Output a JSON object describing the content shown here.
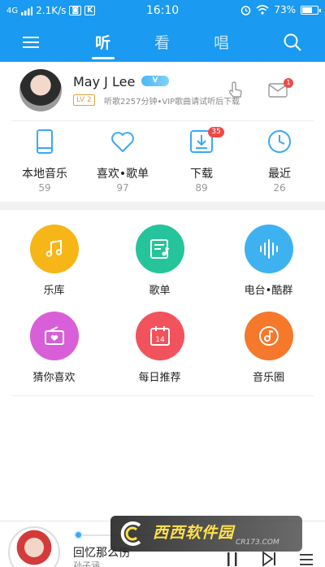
{
  "status_bar": {
    "network": "4G",
    "speed": "2.1K/s",
    "time": "16:10",
    "battery": "73%",
    "battery_level": 0.73
  },
  "top_nav": {
    "tabs": [
      {
        "label": "听",
        "active": true
      },
      {
        "label": "看",
        "active": false
      },
      {
        "label": "唱",
        "active": false
      }
    ]
  },
  "profile": {
    "name": "May J Lee",
    "vip_badge": "V",
    "level": "LV 2",
    "description": "听歌2257分钟•VIP歌曲请试听后下载",
    "mail_badge": "1"
  },
  "shortcuts": [
    {
      "label": "本地音乐",
      "count": "59",
      "icon": "phone-icon"
    },
    {
      "label": "喜欢•歌单",
      "count": "97",
      "icon": "heart-icon"
    },
    {
      "label": "下载",
      "count": "89",
      "icon": "download-icon",
      "badge": "35"
    },
    {
      "label": "最近",
      "count": "26",
      "icon": "clock-icon"
    }
  ],
  "functions": [
    {
      "label": "乐库",
      "icon": "music-note-icon",
      "color": "#f6b618"
    },
    {
      "label": "歌单",
      "icon": "playlist-icon",
      "color": "#25c49a"
    },
    {
      "label": "电台•酷群",
      "icon": "soundwave-icon",
      "color": "#3eb1f0"
    },
    {
      "label": "猜你喜欢",
      "icon": "radio-icon",
      "color": "#d85fd8"
    },
    {
      "label": "每日推荐",
      "icon": "calendar-icon",
      "color": "#f2525c"
    },
    {
      "label": "音乐圈",
      "icon": "disc-icon",
      "color": "#f6782a"
    }
  ],
  "calendar_day": "14",
  "player": {
    "title": "回忆那么伤",
    "artist": "孙子涵",
    "progress": 0.02
  },
  "watermark": {
    "site": "西西软件园",
    "url": "CR173.COM"
  },
  "colors": {
    "brand_blue": "#1a9af0",
    "icon_blue": "#3aa8f5",
    "badge_red": "#f04848"
  }
}
